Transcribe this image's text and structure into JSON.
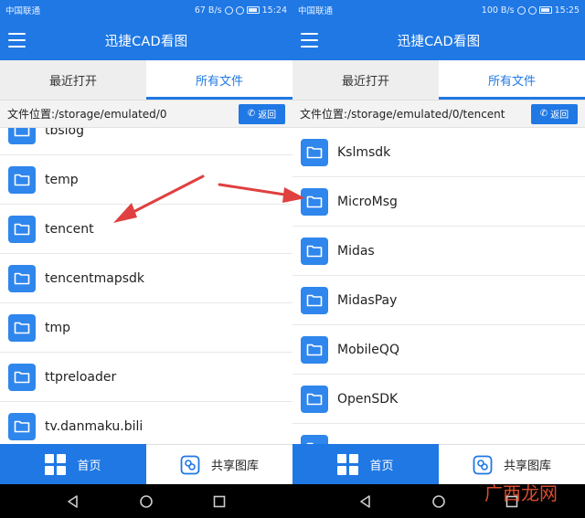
{
  "app": {
    "title": "迅捷CAD看图",
    "tabs": [
      "最近打开",
      "所有文件"
    ],
    "back_label": "返回",
    "bottom_nav": {
      "home": "首页",
      "share": "共享图库"
    },
    "accent": "#1f78e4"
  },
  "left_screen": {
    "status": {
      "carrier": "中国联通",
      "speed": "67 B/s",
      "time": "15:24"
    },
    "path": "文件位置:/storage/emulated/0",
    "files": [
      "tbslog",
      "temp",
      "tencent",
      "tencentmapsdk",
      "tmp",
      "ttpreloader",
      "tv.danmaku.bili"
    ]
  },
  "right_screen": {
    "status": {
      "carrier": "中国联通",
      "speed": "100 B/s",
      "time": "15:25"
    },
    "path": "文件位置:/storage/emulated/0/tencent",
    "files": [
      "Kslmsdk",
      "MicroMsg",
      "Midas",
      "MidasPay",
      "MobileQQ",
      "OpenSDK",
      ""
    ]
  },
  "annotation": {
    "arrow_color": "#e04040"
  },
  "watermark": "广西龙网"
}
